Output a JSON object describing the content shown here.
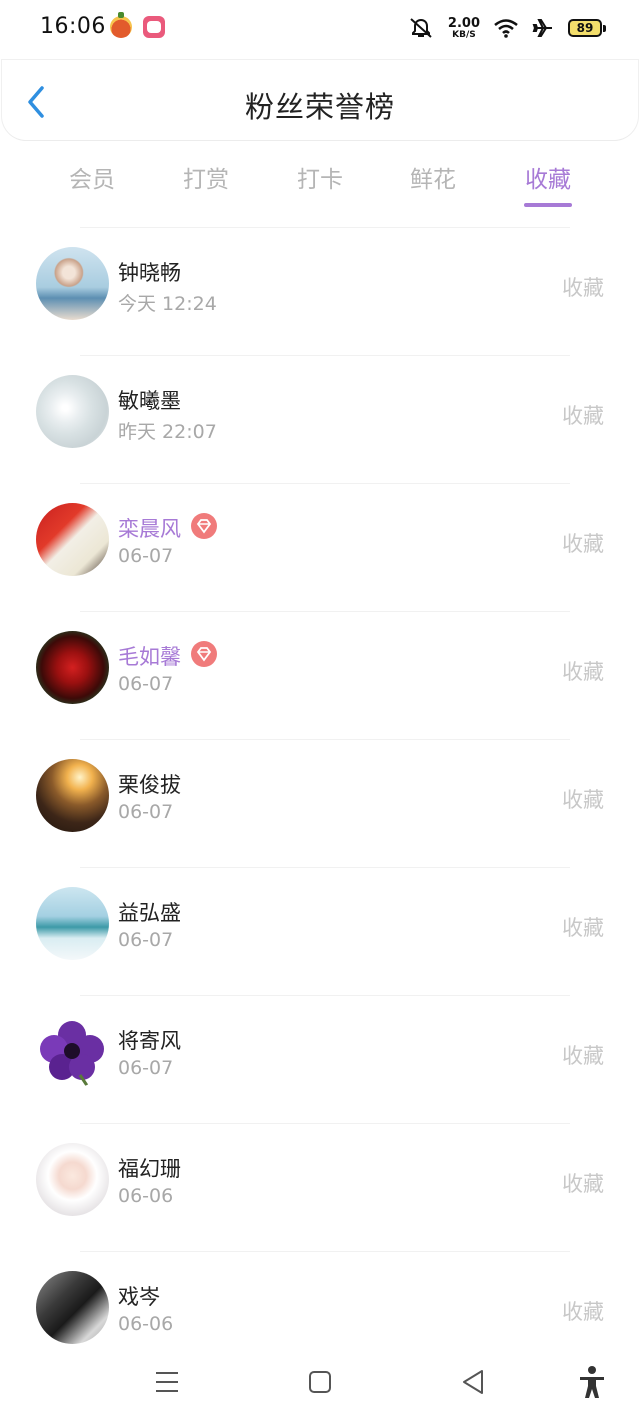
{
  "status_bar": {
    "time": "16:06",
    "net_speed_value": "2.00",
    "net_speed_unit": "KB/S",
    "battery": "89",
    "icons": [
      "notification-app-icon",
      "game-app-icon",
      "mute-icon",
      "wifi-icon",
      "airplane-icon",
      "battery-icon"
    ]
  },
  "header": {
    "title": "粉丝荣誉榜",
    "back_icon": "chevron-left-icon"
  },
  "tabs": [
    {
      "label": "会员",
      "active": false
    },
    {
      "label": "打赏",
      "active": false
    },
    {
      "label": "打卡",
      "active": false
    },
    {
      "label": "鲜花",
      "active": false
    },
    {
      "label": "收藏",
      "active": true
    }
  ],
  "fans": [
    {
      "name": "钟晓畅",
      "time": "今天 12:24",
      "action": "收藏",
      "vip": false
    },
    {
      "name": "敏曦墨",
      "time": "昨天 22:07",
      "action": "收藏",
      "vip": false
    },
    {
      "name": "栾晨风",
      "time": "06-07",
      "action": "收藏",
      "vip": true
    },
    {
      "name": "毛如馨",
      "time": "06-07",
      "action": "收藏",
      "vip": true
    },
    {
      "name": "栗俊拔",
      "time": "06-07",
      "action": "收藏",
      "vip": false
    },
    {
      "name": "益弘盛",
      "time": "06-07",
      "action": "收藏",
      "vip": false
    },
    {
      "name": "将寄风",
      "time": "06-07",
      "action": "收藏",
      "vip": false
    },
    {
      "name": "福幻珊",
      "time": "06-06",
      "action": "收藏",
      "vip": false
    },
    {
      "name": "戏岑",
      "time": "06-06",
      "action": "收藏",
      "vip": false
    }
  ],
  "nav_bar": {
    "icons": [
      "menu-icon",
      "home-square-icon",
      "back-triangle-icon",
      "accessibility-icon"
    ]
  },
  "colors": {
    "accent": "#a77ad6",
    "vip_badge": "#f07b7b",
    "back_arrow": "#2f8fe0",
    "inactive_tab": "#b5b5b5",
    "action_text": "#c8c8c8"
  }
}
